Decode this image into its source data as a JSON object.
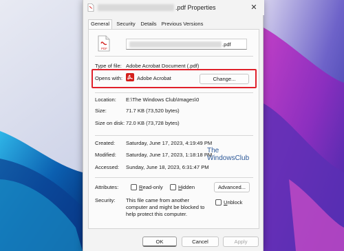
{
  "dialog": {
    "title_suffix": ".pdf Properties",
    "close_glyph": "✕"
  },
  "tabs": [
    {
      "label": "General",
      "active": true
    },
    {
      "label": "Security"
    },
    {
      "label": "Details"
    },
    {
      "label": "Previous Versions"
    }
  ],
  "general": {
    "filename_suffix": ".pdf",
    "file_icon_text": "PDF",
    "type_label": "Type of file:",
    "type_value": "Adobe Acrobat Document (.pdf)",
    "opens_label": "Opens with:",
    "opens_app": "Adobe Acrobat",
    "change_button": "Change...",
    "location_label": "Location:",
    "location_value": "E:\\The Windows Club\\Images\\0",
    "size_label": "Size:",
    "size_value": "71.7 KB (73,520 bytes)",
    "size_on_disk_label": "Size on disk:",
    "size_on_disk_value": "72.0 KB (73,728 bytes)",
    "created_label": "Created:",
    "created_value": "Saturday, June 17, 2023, 4:19:49 PM",
    "modified_label": "Modified:",
    "modified_value": "Saturday, June 17, 2023, 1:18:18 PM",
    "accessed_label": "Accessed:",
    "accessed_value": "Sunday, June 18, 2023, 6:31:47 PM",
    "attributes_label": "Attributes:",
    "readonly_label": "Read-only",
    "hidden_label": "Hidden",
    "advanced_button": "Advanced...",
    "security_label": "Security:",
    "security_text_1": "This file came from another",
    "security_text_2": "computer and might be blocked to",
    "security_text_3": "help protect this computer.",
    "unblock_label": "Unblock"
  },
  "footer": {
    "ok": "OK",
    "cancel": "Cancel",
    "apply": "Apply"
  },
  "watermark": {
    "line1": "The",
    "line2": "WindowsClub"
  },
  "colors": {
    "highlight": "#e0202a",
    "pdf_red": "#d4201d",
    "watermark": "#2b5797"
  }
}
